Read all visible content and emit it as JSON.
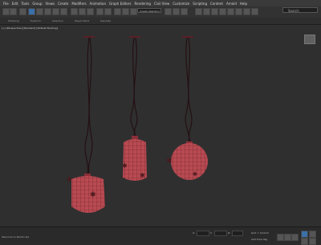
{
  "menu": {
    "items": [
      "File",
      "Edit",
      "Tools",
      "Group",
      "Views",
      "Create",
      "Modifiers",
      "Animation",
      "Graph Editors",
      "Rendering",
      "Civil View",
      "Customize",
      "Scripting",
      "Content",
      "Arnold",
      "Help"
    ]
  },
  "toolbar": {
    "selection_set_placeholder": "Create Selection Set",
    "search_placeholder": "Search"
  },
  "ribbon": {
    "items": [
      "Modeling",
      "Freeform",
      "Selection",
      "Object Paint",
      "Populate"
    ]
  },
  "viewport": {
    "label": "[+] [Perspective] [Standard] [Default Shading]"
  },
  "status": {
    "left_text": "Welcome to MAXScript",
    "x_label": "X:",
    "y_label": "Y:",
    "z_label": "Z:",
    "grid_text": "Grid = 10.0cm",
    "time_tag": "Add Time Tag"
  },
  "colors": {
    "mesh_red": "#b84a52",
    "wire": "#1e1012",
    "background": "#2f2f2f"
  }
}
